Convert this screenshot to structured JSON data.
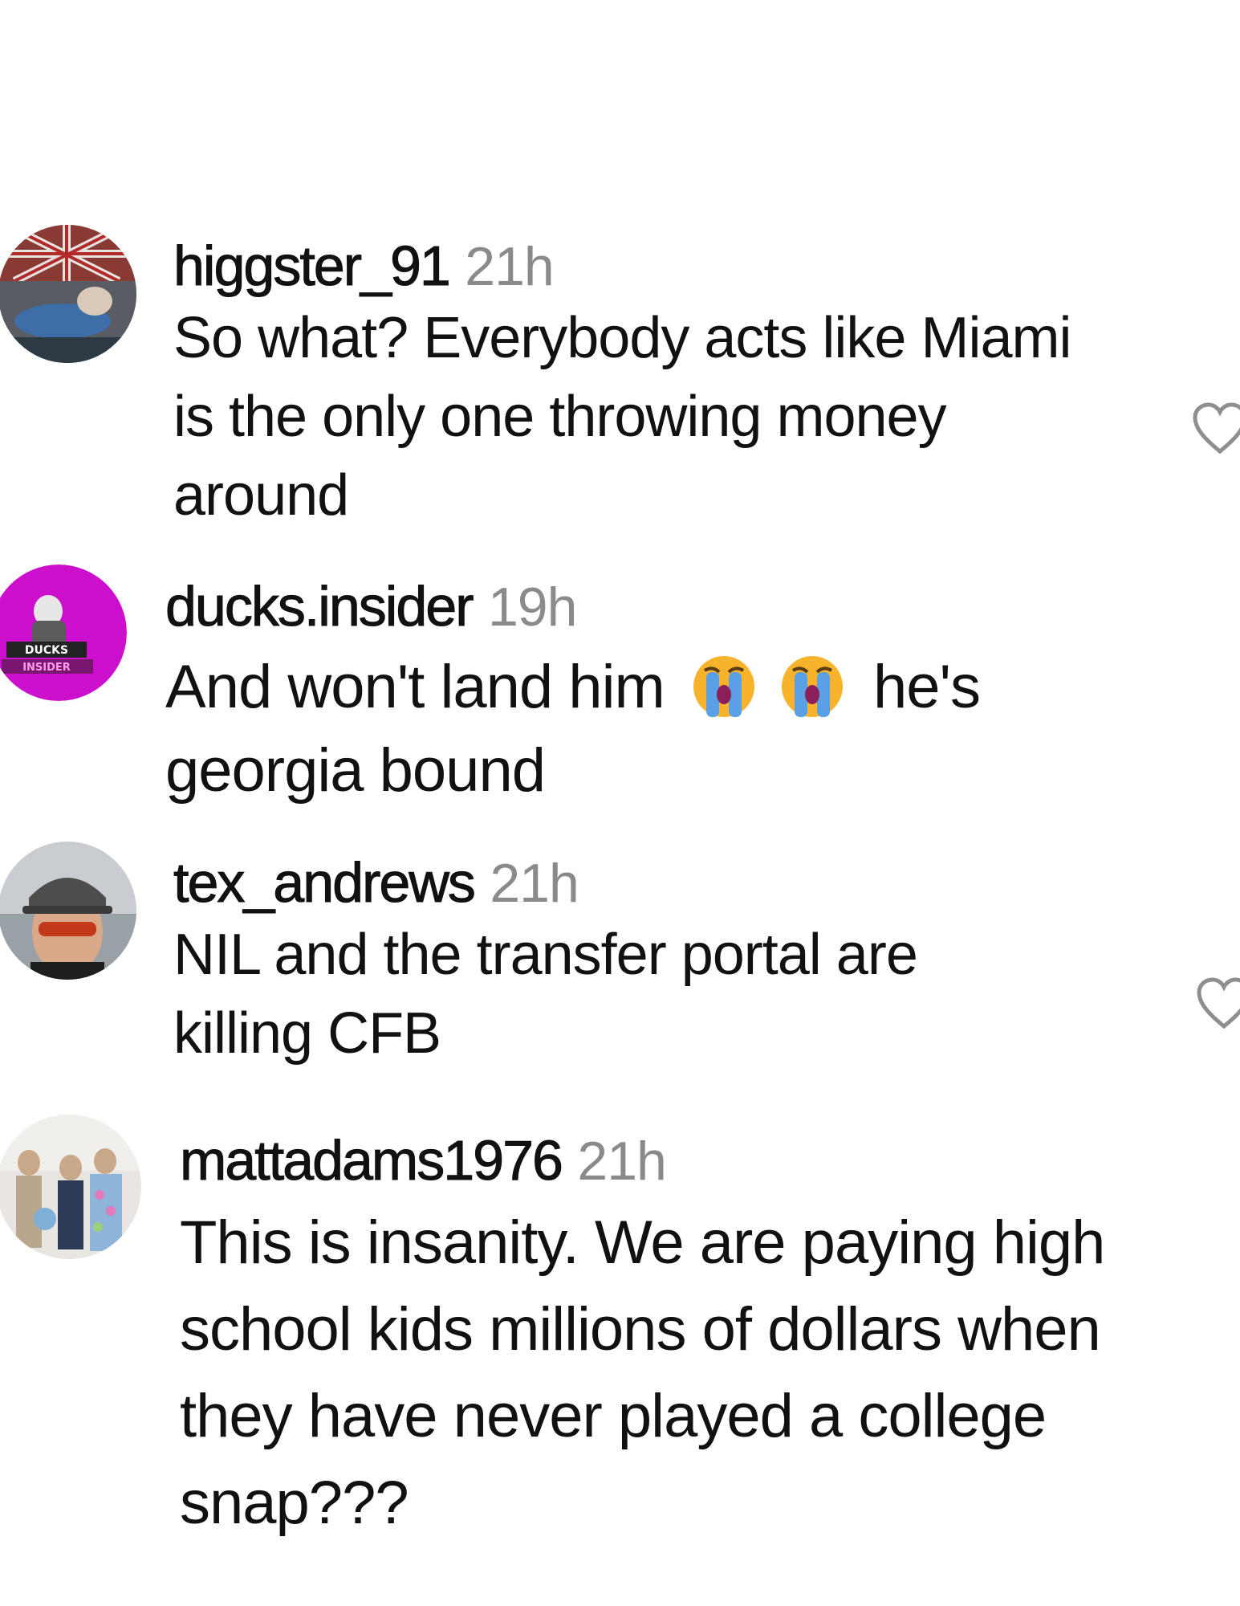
{
  "comments": [
    {
      "username": "higgster_91",
      "time": "21h",
      "lines": [
        "So what? Everybody acts like Miami",
        "is the only one throwing money",
        "around"
      ],
      "avatar": "avatar-higgster",
      "has_like": true
    },
    {
      "username": "ducks.insider",
      "time": "19h",
      "line1_before": "And won't land him",
      "line1_after": "he's",
      "lines": [
        "georgia bound"
      ],
      "emoji": "loudly-crying-face-emoji",
      "avatar_text_top": "DUCKS",
      "avatar_text_bottom": "INSIDER",
      "avatar_color": "#cc0fcc",
      "has_like": false
    },
    {
      "username": "tex_andrews",
      "time": "21h",
      "lines": [
        "NIL and the transfer portal are",
        "killing CFB"
      ],
      "avatar": "avatar-tex",
      "has_like": true
    },
    {
      "username": "mattadams1976",
      "time": "21h",
      "lines": [
        "This is insanity. We are paying high",
        "school kids millions of dollars when",
        "they have never played a college",
        "snap???"
      ],
      "avatar": "avatar-matt",
      "has_like": false
    }
  ],
  "colors": {
    "text": "#111111",
    "timestamp": "#8a8a8a",
    "heart_stroke": "#8e8e8e"
  }
}
